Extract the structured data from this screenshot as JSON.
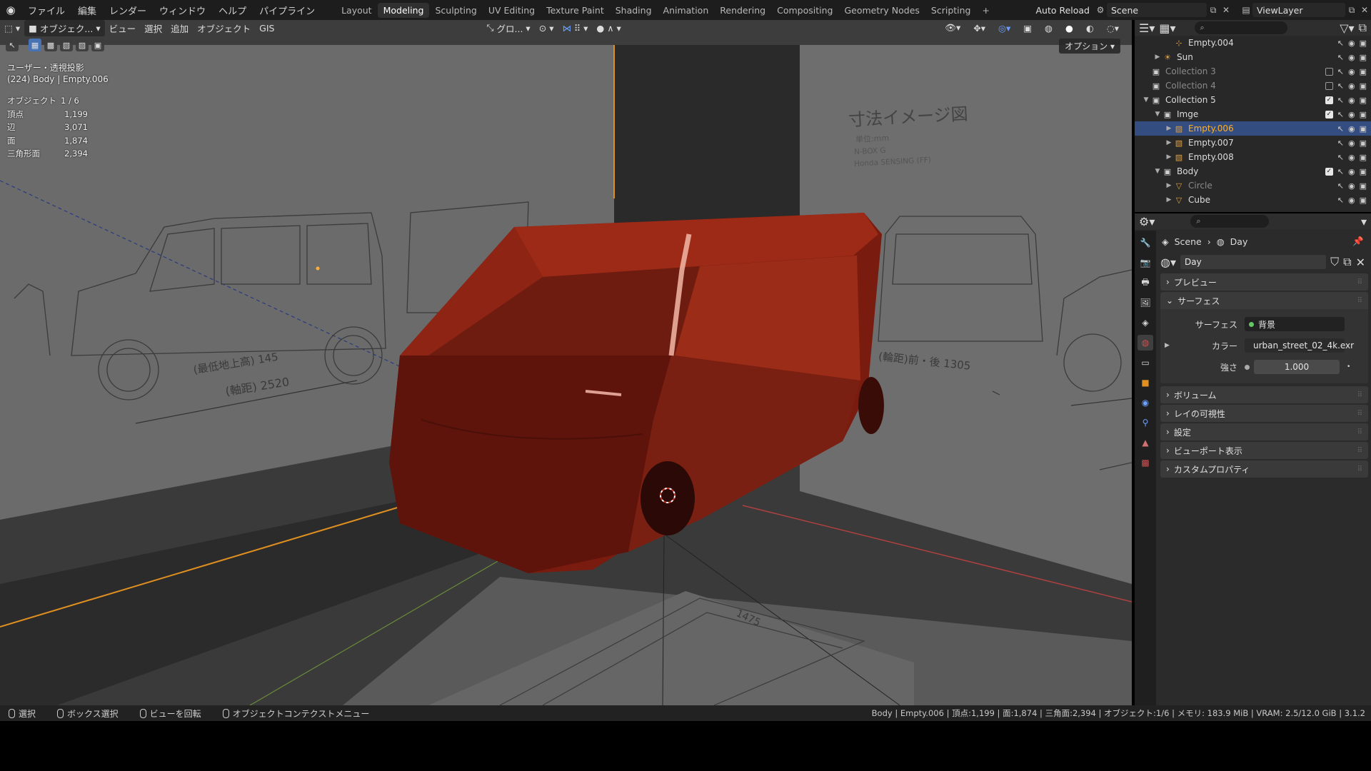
{
  "topbar": {
    "menus": [
      "ファイル",
      "編集",
      "レンダー",
      "ウィンドウ",
      "ヘルプ",
      "パイプライン"
    ],
    "workspaces": [
      "Layout",
      "Modeling",
      "Sculpting",
      "UV Editing",
      "Texture Paint",
      "Shading",
      "Animation",
      "Rendering",
      "Compositing",
      "Geometry Nodes",
      "Scripting"
    ],
    "active_workspace": "Modeling",
    "auto_reload": "Auto Reload",
    "scene": "Scene",
    "view_layer": "ViewLayer"
  },
  "viewport": {
    "mode": "オブジェク...",
    "menus": [
      "ビュー",
      "選択",
      "追加",
      "オブジェクト",
      "GIS"
    ],
    "orientation": "グロ...",
    "options": "オプション",
    "view_name": "ユーザー・透視投影",
    "active_info": "(224) Body | Empty.006",
    "stats": [
      {
        "k": "オブジェクト",
        "v": "1 / 6"
      },
      {
        "k": "頂点",
        "v": "1,199"
      },
      {
        "k": "辺",
        "v": "3,071"
      },
      {
        "k": "面",
        "v": "1,874"
      },
      {
        "k": "三角形面",
        "v": "2,394"
      }
    ],
    "blueprint": {
      "title": "寸法イメージ図",
      "unit": "単位:mm",
      "model": "N-BOX G",
      "variant": "Honda SENSING (FF)",
      "dim1": "(最低地上高) 145",
      "dim2": "(軸距) 2520",
      "dim3": "(輪距)前・後 1305",
      "dim4": "1475"
    }
  },
  "outliner": {
    "rows": [
      {
        "label": "Empty.004",
        "indent": 3,
        "icon": "empty",
        "arrow": "",
        "dim": false,
        "sel": false,
        "checkbox": "none"
      },
      {
        "label": "Sun",
        "indent": 2,
        "icon": "light",
        "arrow": "▶",
        "dim": false,
        "sel": false,
        "checkbox": "none"
      },
      {
        "label": "Collection 3",
        "indent": 1,
        "icon": "collection",
        "arrow": "",
        "dim": true,
        "sel": false,
        "checkbox": "off"
      },
      {
        "label": "Collection 4",
        "indent": 1,
        "icon": "collection",
        "arrow": "",
        "dim": true,
        "sel": false,
        "checkbox": "off"
      },
      {
        "label": "Collection 5",
        "indent": 1,
        "icon": "collection",
        "arrow": "▼",
        "dim": false,
        "sel": false,
        "checkbox": "on"
      },
      {
        "label": "Imge",
        "indent": 2,
        "icon": "collection",
        "arrow": "▼",
        "dim": false,
        "sel": false,
        "checkbox": "on"
      },
      {
        "label": "Empty.006",
        "indent": 3,
        "icon": "image-empty",
        "arrow": "▶",
        "dim": false,
        "sel": true,
        "checkbox": "none"
      },
      {
        "label": "Empty.007",
        "indent": 3,
        "icon": "image-empty",
        "arrow": "▶",
        "dim": false,
        "sel": false,
        "checkbox": "none"
      },
      {
        "label": "Empty.008",
        "indent": 3,
        "icon": "image-empty",
        "arrow": "▶",
        "dim": false,
        "sel": false,
        "checkbox": "none"
      },
      {
        "label": "Body",
        "indent": 2,
        "icon": "collection",
        "arrow": "▼",
        "dim": false,
        "sel": false,
        "checkbox": "on"
      },
      {
        "label": "Circle",
        "indent": 3,
        "icon": "mesh",
        "arrow": "▶",
        "dim": true,
        "sel": false,
        "checkbox": "none"
      },
      {
        "label": "Cube",
        "indent": 3,
        "icon": "mesh",
        "arrow": "▶",
        "dim": false,
        "sel": false,
        "checkbox": "none"
      }
    ]
  },
  "properties": {
    "breadcrumb_scene": "Scene",
    "breadcrumb_world": "Day",
    "world_name": "Day",
    "panels": {
      "preview": "プレビュー",
      "surface": "サーフェス",
      "volume": "ボリューム",
      "ray_visibility": "レイの可視性",
      "settings": "設定",
      "viewport_display": "ビューポート表示",
      "custom_props": "カスタムプロパティ"
    },
    "surface_label": "サーフェス",
    "surface_value": "背景",
    "color_label": "カラー",
    "color_value": "urban_street_02_4k.exr",
    "strength_label": "強さ",
    "strength_value": "1.000"
  },
  "statusbar": {
    "select": "選択",
    "box_select": "ボックス選択",
    "rotate": "ビューを回転",
    "context_menu": "オブジェクトコンテクストメニュー",
    "right_info": "Body | Empty.006 | 頂点:1,199 | 面:1,874 | 三角面:2,394 | オブジェクト:1/6 | メモリ: 183.9 MiB | VRAM: 2.5/12.0 GiB | 3.1.2"
  },
  "colors": {
    "accent": "#4772b3",
    "selection_row": "#334d80",
    "car_body": "#8b1e10",
    "active_object": "#ffaf29"
  }
}
